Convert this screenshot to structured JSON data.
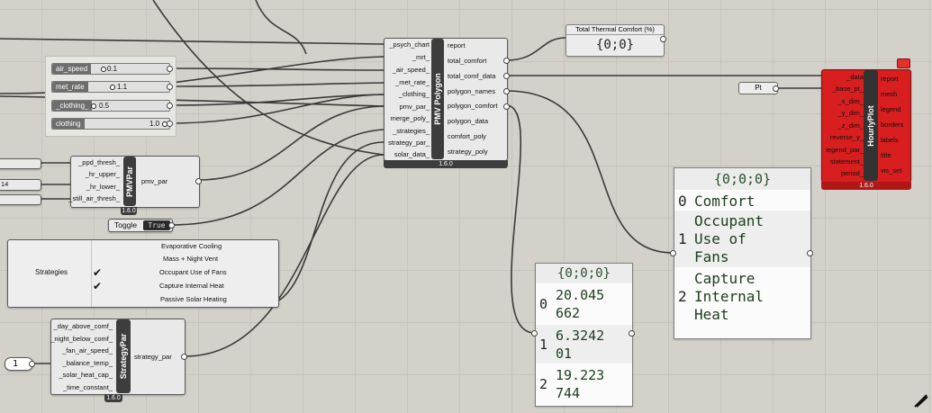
{
  "pmv_polygon": {
    "title": "PMV Polygon",
    "version": "1.6.0",
    "inputs": [
      "_psych_chart",
      "_mrt_",
      "_air_speed_",
      "_met_rate_",
      "_clothing_",
      "pmv_par_",
      "merge_poly_",
      "_strategies_",
      "strategy_par_",
      "solar_data_"
    ],
    "outputs": [
      "report",
      "total_comfort",
      "total_comf_data",
      "polygon_names",
      "polygon_comfort",
      "polygon_data",
      "comfort_poly",
      "strategy_poly"
    ]
  },
  "sliders": [
    {
      "name": "air_speed",
      "value": "0.1"
    },
    {
      "name": "met_rate",
      "value": "1.1"
    },
    {
      "name": "_clothing_",
      "value": "0.5"
    },
    {
      "name": "clothing",
      "value": "1.0"
    }
  ],
  "pmv_par": {
    "title": "PMVPar",
    "version": "1.6.0",
    "inputs": [
      "_ppd_thresh_",
      "_hr_upper_",
      "_hr_lower_",
      "_still_air_thresh_"
    ],
    "output": "pmv_par"
  },
  "left_partial": {
    "label_14": "14"
  },
  "toggle": {
    "label": "Toggle",
    "value": "True"
  },
  "strategies": {
    "label": "Strategies",
    "items": [
      {
        "label": "Evaporative Cooling",
        "checked": false
      },
      {
        "label": "Mass + Night Vent",
        "checked": false
      },
      {
        "label": "Occupant Use of Fans",
        "checked": true
      },
      {
        "label": "Capture Internal Heat",
        "checked": true
      },
      {
        "label": "Passive Solar Heating",
        "checked": false
      }
    ]
  },
  "strategy_par": {
    "title": "StrategyPar",
    "version": "1.6.0",
    "inputs": [
      "_day_above_comf_",
      "_night_below_comf_",
      "_fan_air_speed_",
      "_balance_temp_",
      "_solar_heat_cap_",
      "_time_constant_"
    ],
    "output": "strategy_par"
  },
  "number_input": {
    "value": "1"
  },
  "total_thermal_comfort": {
    "title": "Total Thermal Comfort (%)",
    "value": "{0;0}"
  },
  "pt": {
    "label": "Pt"
  },
  "hourly_plot": {
    "title": "HourlyPlot",
    "version": "1.6.0",
    "inputs": [
      "_data",
      "_base_pt_",
      "_x_dim_",
      "_y_dim_",
      "_z_dim_",
      "reverse_y_",
      "legend_par_",
      "statement_",
      "period_"
    ],
    "outputs": [
      "report",
      "mesh",
      "legend",
      "borders",
      "labels",
      "title",
      "vis_set"
    ]
  },
  "names_panel": {
    "path": "{0;0;0}",
    "rows": [
      {
        "index": "0",
        "lines": [
          "Comfort"
        ]
      },
      {
        "index": "1",
        "lines": [
          "Occupant",
          "Use of",
          "Fans"
        ]
      },
      {
        "index": "2",
        "lines": [
          "Capture",
          "Internal",
          "Heat"
        ]
      }
    ]
  },
  "comfort_panel": {
    "path": "{0;0;0}",
    "rows": [
      {
        "index": "0",
        "lines": [
          "20.045",
          "662"
        ]
      },
      {
        "index": "1",
        "lines": [
          "6.3242",
          "01"
        ]
      },
      {
        "index": "2",
        "lines": [
          "19.223",
          "744"
        ]
      }
    ]
  },
  "colors": {
    "canvas": "#d4d1cb",
    "wire": "#3a3a3a",
    "hourly_plot": "#d81e1e",
    "component": "#e9e9e9"
  }
}
